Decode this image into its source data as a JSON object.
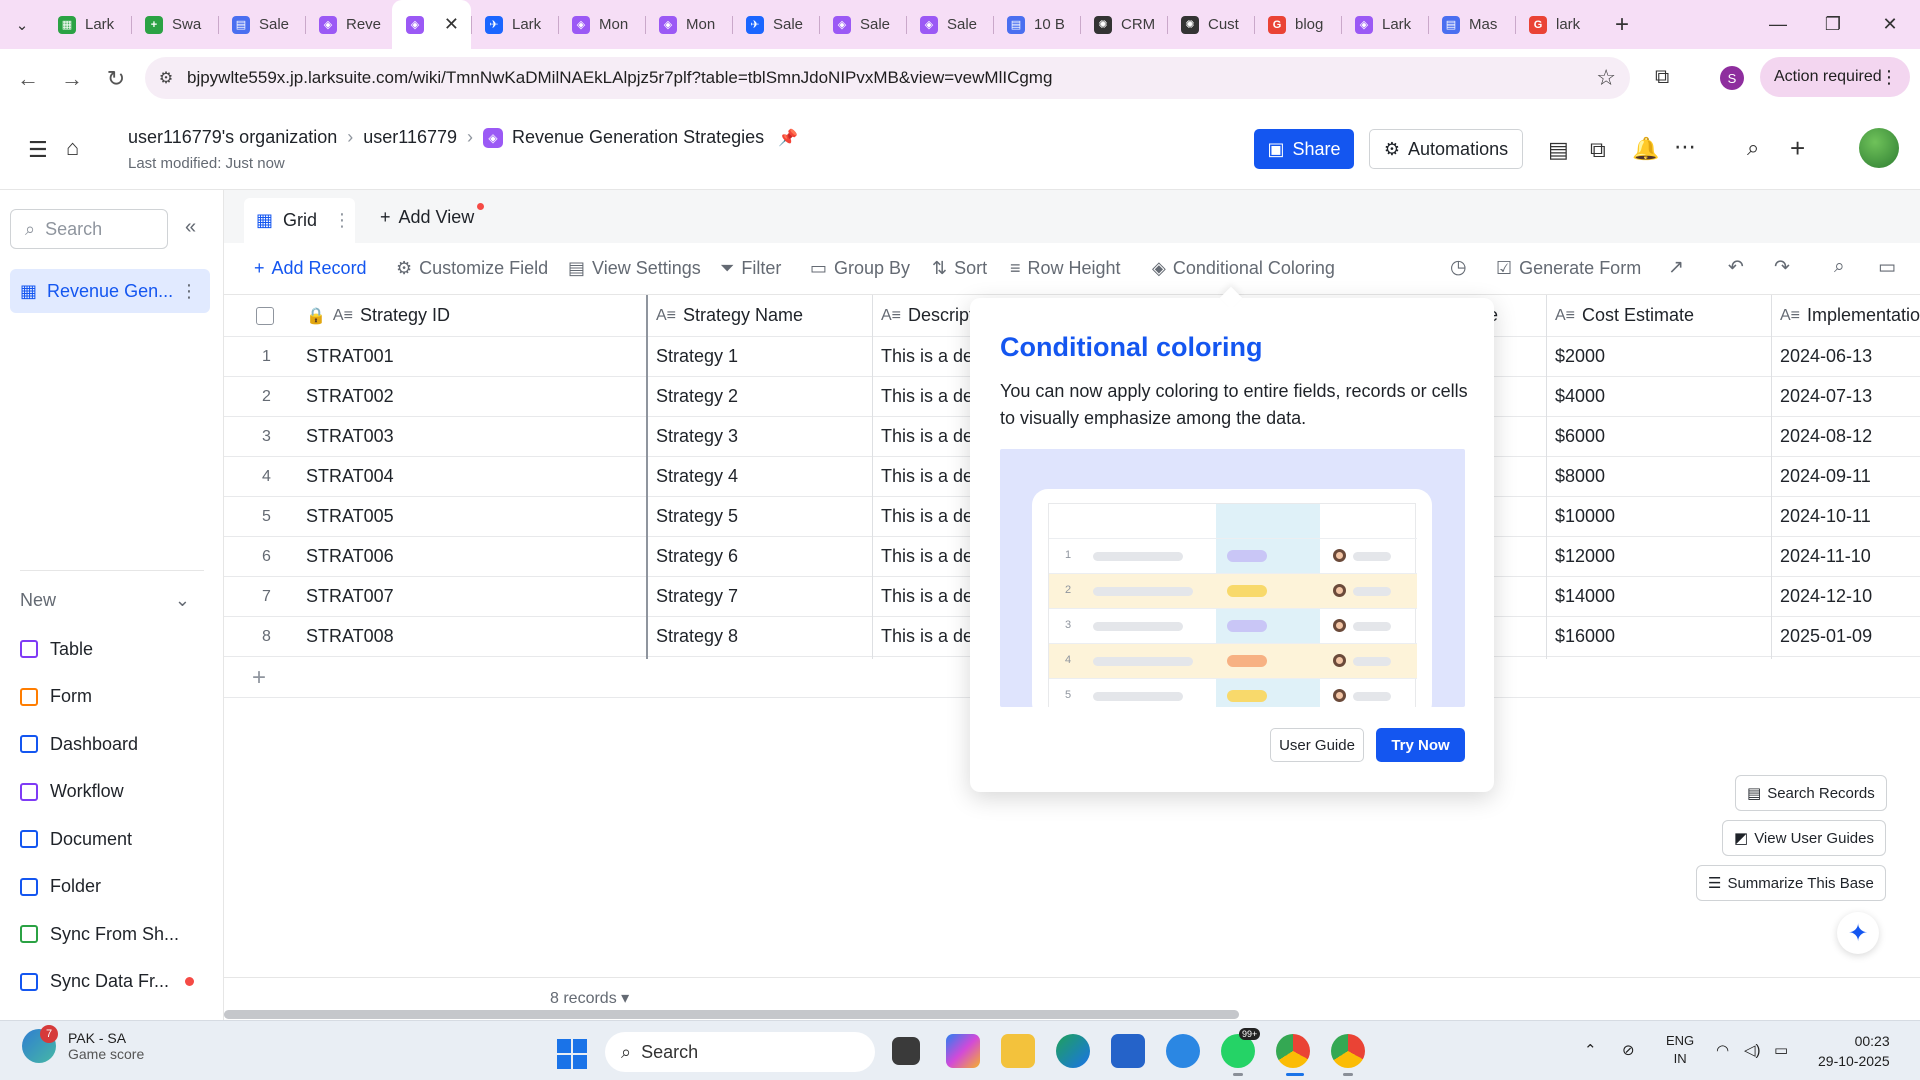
{
  "browser": {
    "tabs": [
      {
        "label": "Lark",
        "color": "#2ba244",
        "glyph": "▦"
      },
      {
        "label": "Swa",
        "color": "#2ba244",
        "glyph": "+"
      },
      {
        "label": "Sale",
        "color": "#4a6ff0",
        "glyph": "▤"
      },
      {
        "label": "Reve",
        "color": "#9b59f5",
        "glyph": "◈"
      },
      {
        "label": "",
        "color": "#9b59f5",
        "glyph": "◈",
        "active": true
      },
      {
        "label": "Lark",
        "color": "#1b66ff",
        "glyph": "✈"
      },
      {
        "label": "Mon",
        "color": "#9b59f5",
        "glyph": "◈"
      },
      {
        "label": "Mon",
        "color": "#9b59f5",
        "glyph": "◈"
      },
      {
        "label": "Sale",
        "color": "#1b66ff",
        "glyph": "✈"
      },
      {
        "label": "Sale",
        "color": "#9b59f5",
        "glyph": "◈"
      },
      {
        "label": "Sale",
        "color": "#9b59f5",
        "glyph": "◈"
      },
      {
        "label": "10 B",
        "color": "#4a6ff0",
        "glyph": "▤"
      },
      {
        "label": "CRM",
        "color": "#333333",
        "glyph": "✺"
      },
      {
        "label": "Cust",
        "color": "#333333",
        "glyph": "✺"
      },
      {
        "label": "blog",
        "color": "#ea4335",
        "glyph": "G"
      },
      {
        "label": "Lark",
        "color": "#9b59f5",
        "glyph": "◈"
      },
      {
        "label": "Mas",
        "color": "#4a6ff0",
        "glyph": "▤"
      },
      {
        "label": "lark",
        "color": "#ea4335",
        "glyph": "G"
      }
    ],
    "url": "bjpywlte559x.jp.larksuite.com/wiki/TmnNwKaDMilNAEkLAlpjz5r7plf?table=tblSmnJdoNIPvxMB&view=vewMlICgmg",
    "profile_initial": "S",
    "action_required": "Action required"
  },
  "header": {
    "breadcrumb": [
      "user116779's organization",
      "user116779",
      "Revenue Generation Strategies"
    ],
    "last_modified": "Last modified: Just now",
    "share_label": "Share",
    "automations_label": "Automations"
  },
  "sidebar": {
    "search_placeholder": "Search",
    "table_name": "Revenue Gen...",
    "new_label": "New",
    "new_items": [
      {
        "label": "Table",
        "color": "#7f3bf5"
      },
      {
        "label": "Form",
        "color": "#ff7d00"
      },
      {
        "label": "Dashboard",
        "color": "#1456f0"
      },
      {
        "label": "Workflow",
        "color": "#7f3bf5"
      },
      {
        "label": "Document",
        "color": "#1456f0"
      },
      {
        "label": "Folder",
        "color": "#1456f0"
      },
      {
        "label": "Sync From Sh...",
        "color": "#2ba244"
      },
      {
        "label": "Sync Data Fr...",
        "color": "#1456f0"
      }
    ]
  },
  "views": {
    "grid_label": "Grid",
    "add_view_label": "Add View"
  },
  "toolbar": {
    "add_record": "Add Record",
    "customize_field": "Customize Field",
    "view_settings": "View Settings",
    "filter": "Filter",
    "group_by": "Group By",
    "sort": "Sort",
    "row_height": "Row Height",
    "conditional_coloring": "Conditional Coloring",
    "generate_form": "Generate Form"
  },
  "grid": {
    "columns": [
      "Strategy ID",
      "Strategy Name",
      "Descript",
      "Cost Estimate",
      "Implementatio"
    ],
    "rows": [
      {
        "n": "1",
        "id": "STRAT001",
        "name": "Strategy 1",
        "desc": "This is a de",
        "cost": "$2000",
        "impl": "2024-06-13"
      },
      {
        "n": "2",
        "id": "STRAT002",
        "name": "Strategy 2",
        "desc": "This is a de",
        "cost": "$4000",
        "impl": "2024-07-13"
      },
      {
        "n": "3",
        "id": "STRAT003",
        "name": "Strategy 3",
        "desc": "This is a de",
        "cost": "$6000",
        "impl": "2024-08-12"
      },
      {
        "n": "4",
        "id": "STRAT004",
        "name": "Strategy 4",
        "desc": "This is a de",
        "cost": "$8000",
        "impl": "2024-09-11"
      },
      {
        "n": "5",
        "id": "STRAT005",
        "name": "Strategy 5",
        "desc": "This is a de",
        "cost": "$10000",
        "impl": "2024-10-11"
      },
      {
        "n": "6",
        "id": "STRAT006",
        "name": "Strategy 6",
        "desc": "This is a de",
        "cost": "$12000",
        "impl": "2024-11-10"
      },
      {
        "n": "7",
        "id": "STRAT007",
        "name": "Strategy 7",
        "desc": "This is a de",
        "cost": "$14000",
        "impl": "2024-12-10"
      },
      {
        "n": "8",
        "id": "STRAT008",
        "name": "Strategy 8",
        "desc": "This is a de",
        "cost": "$16000",
        "impl": "2025-01-09"
      }
    ],
    "record_count": "8 records",
    "partial_header": "e"
  },
  "popover": {
    "title": "Conditional coloring",
    "description": "You can now apply coloring to entire fields, records or cells to visually emphasize among the data.",
    "user_guide": "User Guide",
    "try_now": "Try Now",
    "illustration_rows": [
      "1",
      "2",
      "3",
      "4",
      "5"
    ]
  },
  "fabs": {
    "search_records": "Search Records",
    "view_user_guides": "View User Guides",
    "summarize": "Summarize This Base"
  },
  "taskbar": {
    "weather_title": "PAK - SA",
    "weather_sub": "Game score",
    "weather_badge": "7",
    "search_label": "Search",
    "lang1": "ENG",
    "lang2": "IN",
    "time": "00:23",
    "date": "29-10-2025",
    "whatsapp_badge": "99+"
  }
}
